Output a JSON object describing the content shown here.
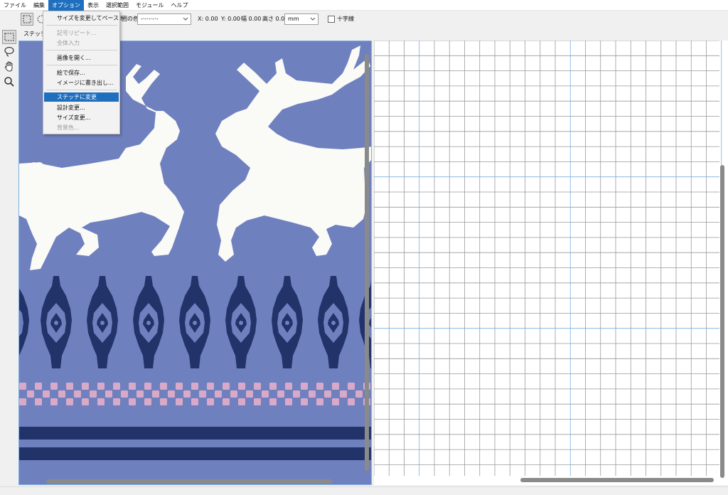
{
  "menubar": [
    {
      "label": "ファイル",
      "active": false
    },
    {
      "label": "編集",
      "active": false
    },
    {
      "label": "オプション",
      "active": true
    },
    {
      "label": "表示",
      "active": false
    },
    {
      "label": "選択範囲",
      "active": false
    },
    {
      "label": "モジュール",
      "active": false
    },
    {
      "label": "ヘルプ",
      "active": false
    }
  ],
  "toolbar": {
    "color_label": "囲の色",
    "line_style_value": "-·-·-·-·-",
    "x_label": "X: 0.00",
    "y_label": "Y: 0.00",
    "width_label": "幅 0.00",
    "height_label": "高さ 0.00",
    "unit_value": "mm",
    "crosshair_label": "十字線"
  },
  "subtab": {
    "label": "ステッチ"
  },
  "dropdown": [
    {
      "label": "サイズを変更してペースト",
      "disabled": false
    },
    {
      "label": "記号リピート...",
      "disabled": true
    },
    {
      "label": "全体入力",
      "disabled": true
    },
    {
      "label": "画像を開く...",
      "disabled": false
    },
    {
      "label": "絵で保存...",
      "disabled": false
    },
    {
      "label": "イメージに書き出し...",
      "disabled": false
    },
    {
      "label": "ステッチに変更",
      "disabled": false,
      "highlight": true
    },
    {
      "label": "設計変更...",
      "disabled": false
    },
    {
      "label": "サイズ変更...",
      "disabled": false
    },
    {
      "label": "背景色...",
      "disabled": true
    }
  ],
  "colors": {
    "menu_highlight": "#1f6fbf",
    "design_background": "#6f80bf",
    "reindeer": "#fafaf7",
    "motif_navy": "#22336a",
    "check_pink": "#d8a9c8",
    "grid_line": "#9a9a9a",
    "grid_major": "#7aaee0"
  },
  "icons": [
    "rect-select-icon",
    "lasso-icon",
    "hand-icon",
    "zoom-icon",
    "ellipse-select-icon",
    "chevron-down-icon"
  ]
}
